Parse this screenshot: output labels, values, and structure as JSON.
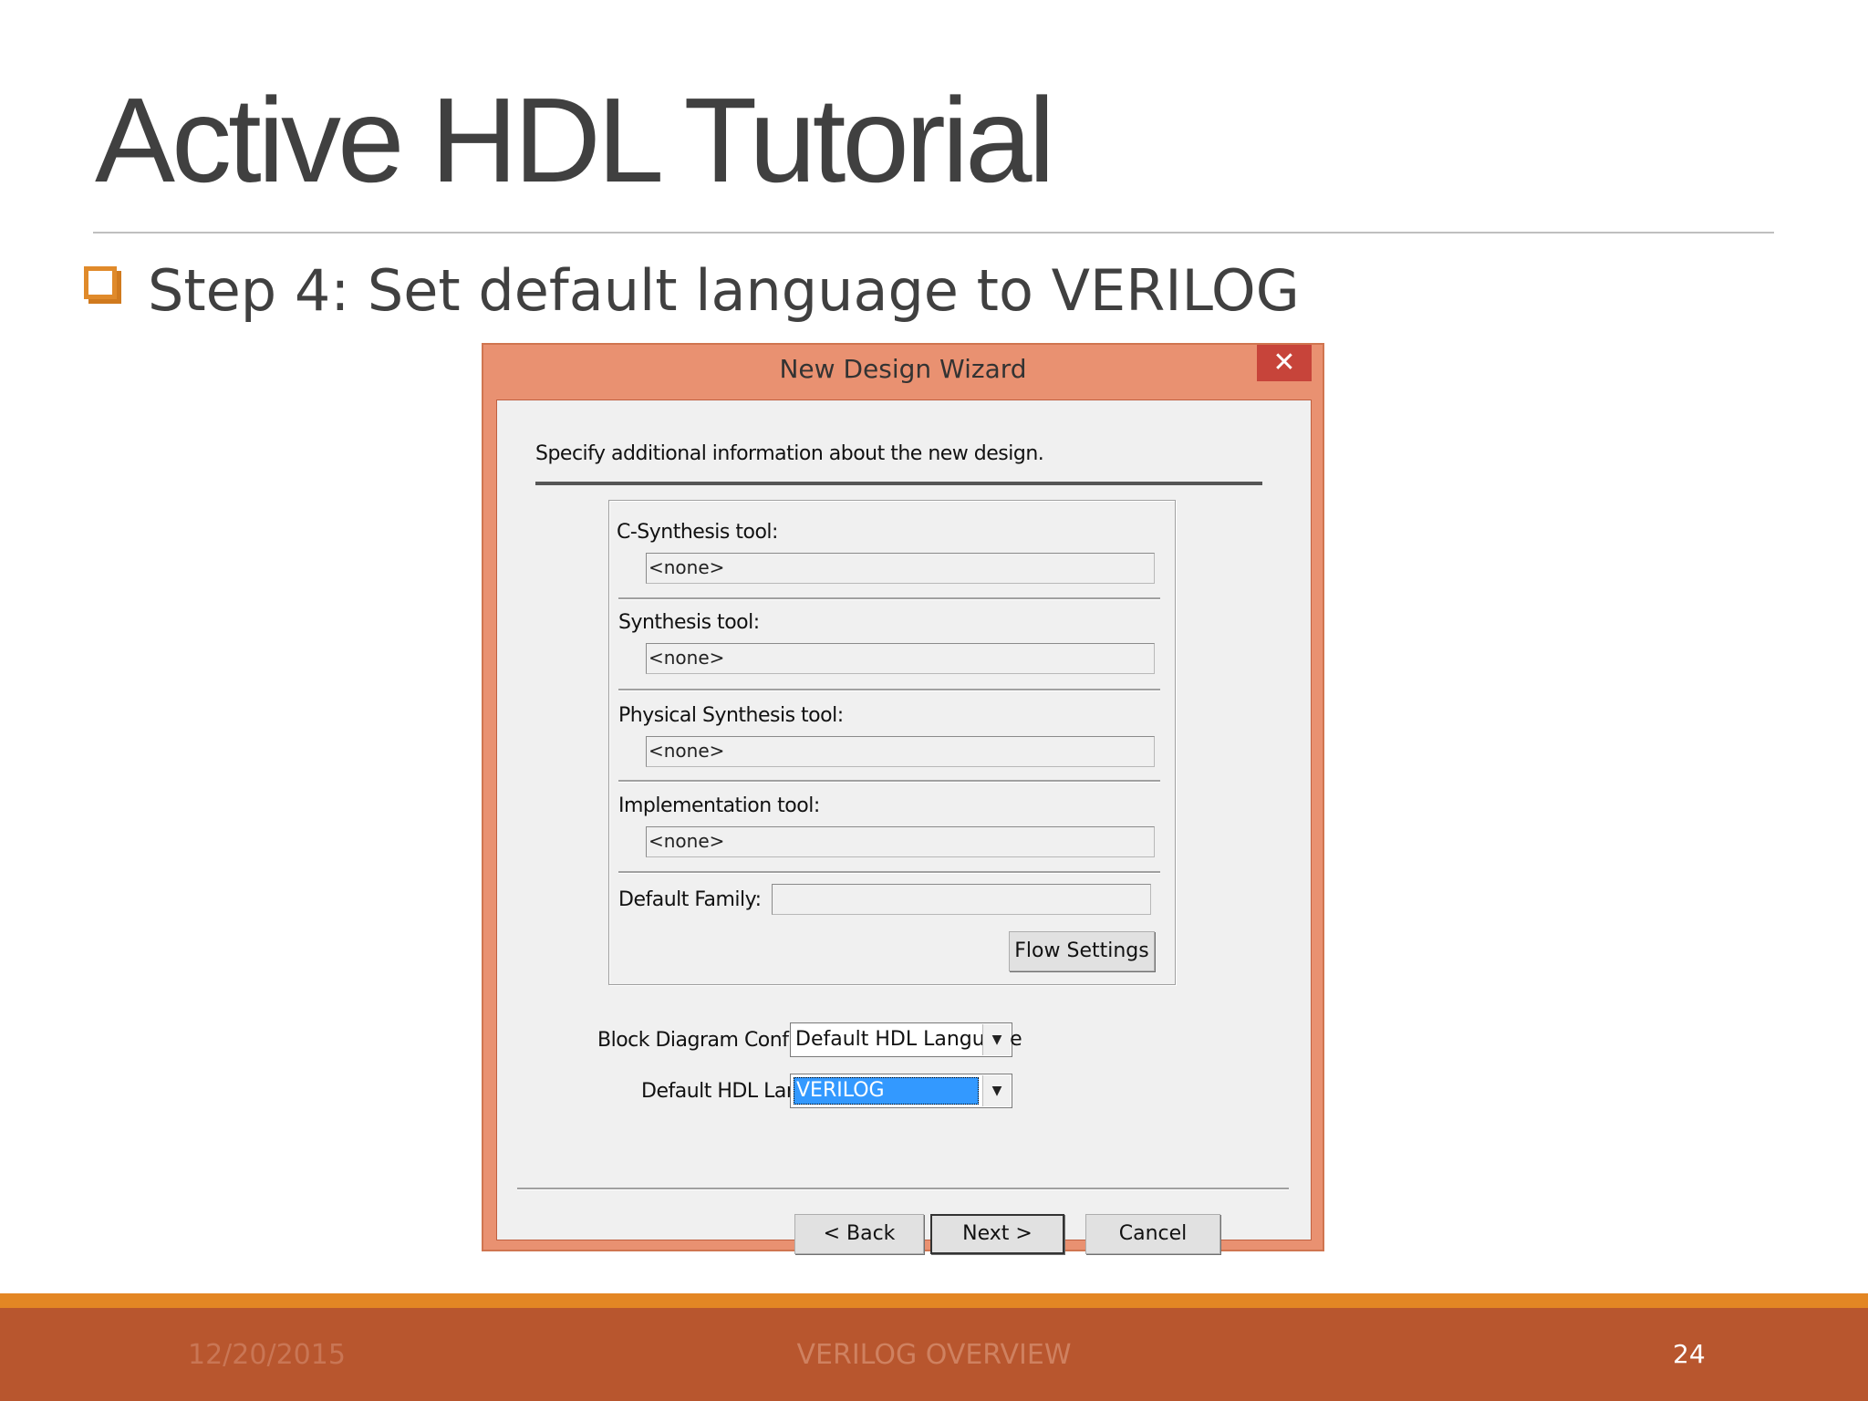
{
  "slide": {
    "title": "Active HDL Tutorial",
    "bullet": "Step 4: Set default language to VERILOG"
  },
  "dialog": {
    "title": "New Design Wizard",
    "close_glyph": "✕",
    "instruction": "Specify additional information about the new design.",
    "c_synthesis_label": "C-Synthesis tool:",
    "c_synthesis_value": "<none>",
    "synthesis_label": "Synthesis tool:",
    "synthesis_value": "<none>",
    "physical_synthesis_label": "Physical Synthesis tool:",
    "physical_synthesis_value": "<none>",
    "implementation_label": "Implementation tool:",
    "implementation_value": "<none>",
    "default_family_label": "Default Family:",
    "default_family_value": "",
    "flow_settings_label": "Flow Settings",
    "block_diagram_label": "Block Diagram Configuration:",
    "block_diagram_value": "Default HDL Language",
    "hdl_language_label": "Default HDL Language:",
    "hdl_language_value": "VERILOG",
    "back_label": "< Back",
    "next_label": "Next >",
    "cancel_label": "Cancel"
  },
  "footer": {
    "date": "12/20/2015",
    "center": "VERILOG OVERVIEW",
    "page": "24"
  },
  "colors": {
    "accent_orange": "#e38624",
    "footer_bar": "#b8562e",
    "dialog_frame": "#e99171",
    "close_button": "#c7443a",
    "selection": "#3399ff"
  },
  "icons": {
    "bullet": "hollow-square-icon",
    "close": "close-icon",
    "dropdown": "chevron-down-icon"
  }
}
